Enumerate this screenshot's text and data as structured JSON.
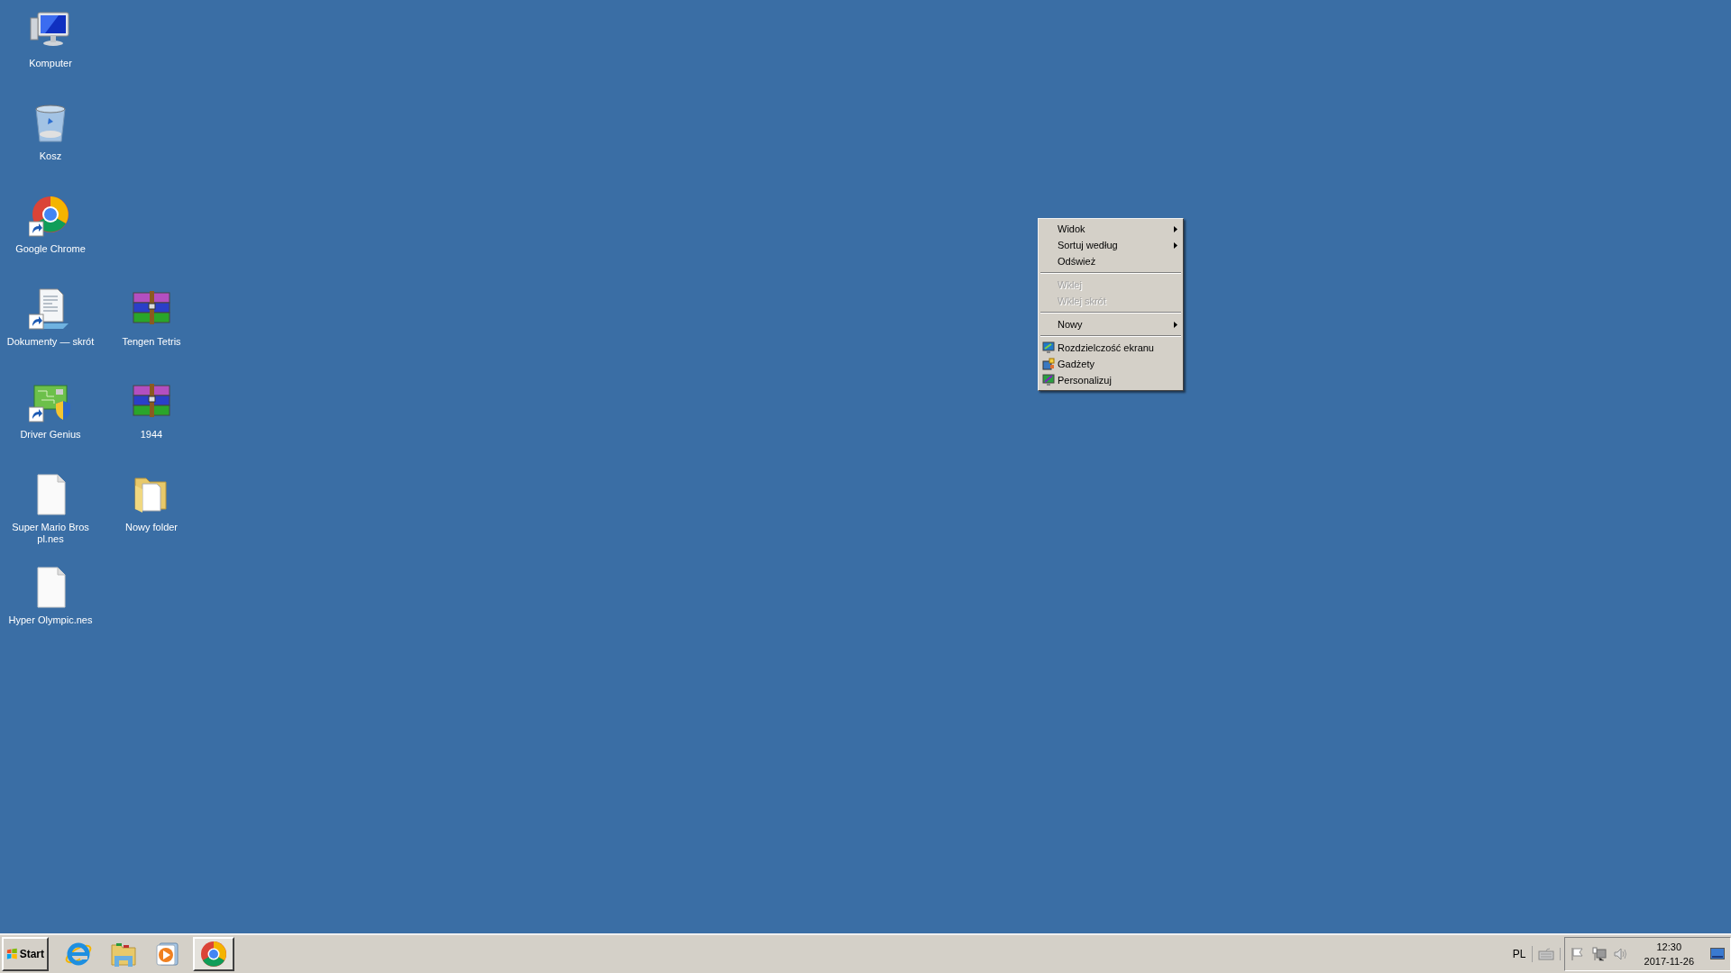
{
  "desktop": {
    "columns": [
      [
        {
          "label": "Komputer",
          "kind": "computer",
          "shortcut": false
        },
        {
          "label": "Kosz",
          "kind": "recycle-bin",
          "shortcut": false
        },
        {
          "label": "Google Chrome",
          "kind": "chrome",
          "shortcut": true
        },
        {
          "label": "Dokumenty — skrót",
          "kind": "document",
          "shortcut": true
        },
        {
          "label": "Driver Genius",
          "kind": "driver",
          "shortcut": true
        },
        {
          "label": "Super Mario Bros pl.nes",
          "kind": "file",
          "shortcut": false
        },
        {
          "label": "Hyper Olympic.nes",
          "kind": "file",
          "shortcut": false
        }
      ],
      [
        {
          "label": "Tengen Tetris",
          "kind": "archive",
          "shortcut": false
        },
        {
          "label": "1944",
          "kind": "archive",
          "shortcut": false
        },
        {
          "label": "Nowy folder",
          "kind": "folder",
          "shortcut": false
        }
      ]
    ]
  },
  "context_menu": {
    "items": [
      {
        "kind": "item",
        "label": "Widok",
        "disabled": false,
        "submenu": true
      },
      {
        "kind": "item",
        "label": "Sortuj według",
        "disabled": false,
        "submenu": true
      },
      {
        "kind": "item",
        "label": "Odśwież",
        "disabled": false,
        "submenu": false
      },
      {
        "kind": "separator"
      },
      {
        "kind": "item",
        "label": "Wklej",
        "disabled": true,
        "submenu": false
      },
      {
        "kind": "item",
        "label": "Wklej skrót",
        "disabled": true,
        "submenu": false
      },
      {
        "kind": "separator"
      },
      {
        "kind": "item",
        "label": "Nowy",
        "disabled": false,
        "submenu": true
      },
      {
        "kind": "separator"
      },
      {
        "kind": "icon_item",
        "label": "Rozdzielczość ekranu",
        "disabled": false,
        "submenu": false
      },
      {
        "kind": "icon_item",
        "label": "Gadżety",
        "disabled": false,
        "submenu": false
      },
      {
        "kind": "icon_item",
        "label": "Personalizuj",
        "disabled": false,
        "submenu": false
      }
    ]
  },
  "taskbar": {
    "start_label": "Start",
    "apps": [
      {
        "kind": "ie",
        "selected": false
      },
      {
        "kind": "explorer",
        "selected": false
      },
      {
        "kind": "media",
        "selected": false
      },
      {
        "kind": "chrome",
        "selected": true
      }
    ],
    "language": "PL",
    "clock": {
      "time": "12:30",
      "date": "2017-11-26"
    }
  }
}
